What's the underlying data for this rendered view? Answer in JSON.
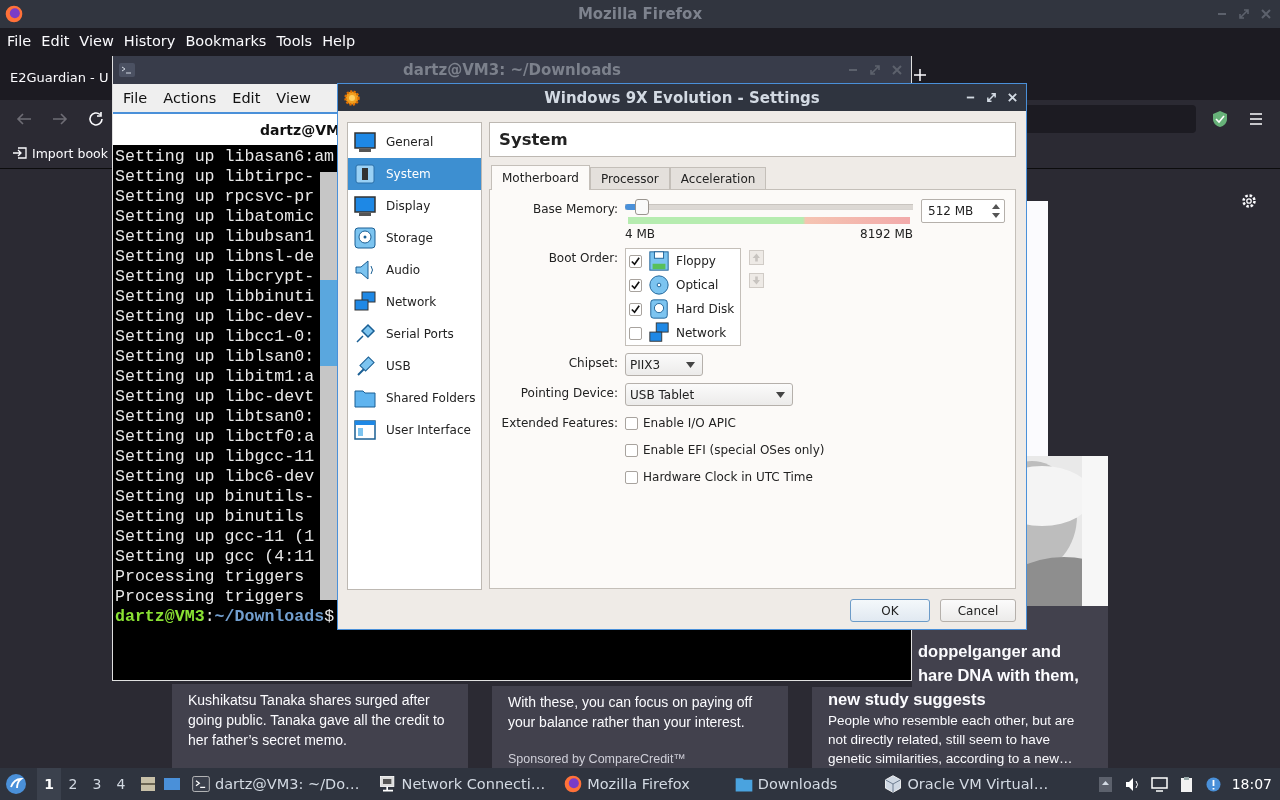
{
  "firefox": {
    "title": "Mozilla Firefox",
    "menu": [
      "File",
      "Edit",
      "View",
      "History",
      "Bookmarks",
      "Tools",
      "Help"
    ],
    "tab": "E2Guardian - U",
    "bookmark": "Import book",
    "news": [
      {
        "kind": "text",
        "body": "Kushikatsu Tanaka shares surged after\ngoing public. Tanaka gave all the credit to\nher father’s secret memo."
      },
      {
        "kind": "sponsored",
        "body": "With these, you can focus on paying off\nyour balance rather than your interest.",
        "sponsor": "Sponsored by CompareCredit™"
      },
      {
        "headline": [
          "doppelganger and",
          "hare DNA with them,",
          "new study suggests"
        ],
        "body": "People who resemble each other, but are\nnot directly related, still seem to have\ngenetic similarities, according to a new…"
      }
    ]
  },
  "terminal": {
    "title": "dartz@VM3: ~/Downloads",
    "menu": [
      "File",
      "Actions",
      "Edit",
      "View"
    ],
    "tab_title": "dartz@VM",
    "lines": [
      "Setting up libasan6:am",
      "Setting up libtirpc-",
      "Setting up rpcsvc-pr",
      "Setting up libatomic",
      "Setting up libubsan1",
      "Setting up libnsl-de",
      "Setting up libcrypt-",
      "Setting up libbinuti",
      "Setting up libc-dev-",
      "Setting up libcc1-0:",
      "Setting up liblsan0:",
      "Setting up libitm1:a",
      "Setting up libc-devt",
      "Setting up libtsan0:",
      "Setting up libctf0:a",
      "Setting up libgcc-11",
      "Setting up libc6-dev",
      "Setting up binutils-",
      "Setting up binutils",
      "Setting up gcc-11 (1",
      "Setting up gcc (4:11",
      "Processing triggers",
      "Processing triggers"
    ],
    "prompt": {
      "user": "dartz@VM3",
      "separator": ":",
      "path": "~/Downloads",
      "symbol": "$"
    }
  },
  "dialog": {
    "title": "Windows 9X Evolution - Settings",
    "sections": [
      {
        "label": "General",
        "selected": false
      },
      {
        "label": "System",
        "selected": true
      },
      {
        "label": "Display",
        "selected": false
      },
      {
        "label": "Storage",
        "selected": false
      },
      {
        "label": "Audio",
        "selected": false
      },
      {
        "label": "Network",
        "selected": false
      },
      {
        "label": "Serial Ports",
        "selected": false
      },
      {
        "label": "USB",
        "selected": false
      },
      {
        "label": "Shared Folders",
        "selected": false
      },
      {
        "label": "User Interface",
        "selected": false
      }
    ],
    "heading": "System",
    "tabs": [
      {
        "label": "Motherboard",
        "selected": true
      },
      {
        "label": "Processor",
        "selected": false
      },
      {
        "label": "Acceleration",
        "selected": false
      }
    ],
    "base_memory": {
      "label": "Base Memory:",
      "level": 0.06,
      "min": "4 MB",
      "max": "8192 MB",
      "value": "512 MB"
    },
    "boot_order": {
      "label": "Boot Order:",
      "items": [
        {
          "label": "Floppy",
          "checked": true
        },
        {
          "label": "Optical",
          "checked": true
        },
        {
          "label": "Hard Disk",
          "checked": true
        },
        {
          "label": "Network",
          "checked": false
        }
      ]
    },
    "chipset": {
      "label": "Chipset:",
      "value": "PIIX3"
    },
    "pointing_device": {
      "label": "Pointing Device:",
      "value": "USB Tablet"
    },
    "extended_features": {
      "label": "Extended Features:",
      "options": [
        {
          "label": "Enable I/O APIC",
          "checked": false
        },
        {
          "label": "Enable EFI (special OSes only)",
          "checked": false
        },
        {
          "label": "Hardware Clock in UTC Time",
          "checked": false
        }
      ]
    },
    "buttons": [
      "OK",
      "Cancel"
    ]
  },
  "taskbar": {
    "workspaces": [
      {
        "label": "1",
        "selected": true
      },
      {
        "label": "2",
        "selected": false
      },
      {
        "label": "3",
        "selected": false
      },
      {
        "label": "4",
        "selected": false
      }
    ],
    "tasks": [
      "dartz@VM3: ~/Do…",
      "Network Connecti…",
      "Mozilla Firefox",
      "Downloads",
      "Oracle VM Virtual…"
    ],
    "clock": "18:07"
  }
}
